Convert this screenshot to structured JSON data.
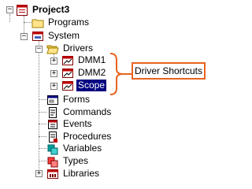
{
  "tree": {
    "root": {
      "label": "Project3",
      "icon": "project-icon",
      "expander": "−"
    },
    "programs": {
      "label": "Programs",
      "icon": "folder-icon"
    },
    "system": {
      "label": "System",
      "icon": "system-icon",
      "expander": "−"
    },
    "drivers": {
      "label": "Drivers",
      "icon": "folder-open-icon",
      "expander": "−"
    },
    "dmm1": {
      "label": "DMM1",
      "icon": "driver-icon",
      "expander": "+"
    },
    "dmm2": {
      "label": "DMM2",
      "icon": "driver-icon",
      "expander": "+"
    },
    "scope": {
      "label": "Scope",
      "icon": "driver-icon",
      "expander": "+",
      "selected": true
    },
    "forms": {
      "label": "Forms",
      "icon": "forms-icon"
    },
    "commands": {
      "label": "Commands",
      "icon": "commands-icon"
    },
    "events": {
      "label": "Events",
      "icon": "events-icon"
    },
    "procedures": {
      "label": "Procedures",
      "icon": "procedures-icon"
    },
    "variables": {
      "label": "Variables",
      "icon": "variables-icon"
    },
    "types": {
      "label": "Types",
      "icon": "types-icon"
    },
    "libraries": {
      "label": "Libraries",
      "icon": "libraries-icon",
      "expander": "+"
    }
  },
  "callout": {
    "label": "Driver Shortcuts",
    "border_color": "#e8641e"
  },
  "colors": {
    "selection": "#000080",
    "guide_lines": "#808080",
    "callout_accent": "#e8641e"
  }
}
